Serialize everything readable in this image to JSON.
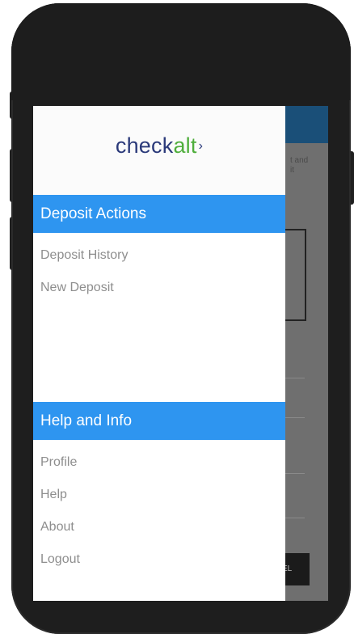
{
  "logo": {
    "part1": "check",
    "part2": "alt",
    "mark": "›"
  },
  "background": {
    "hint_text": "t and\nit",
    "button_text": "EL"
  },
  "drawer": {
    "sections": [
      {
        "title": "Deposit Actions",
        "items": [
          "Deposit History",
          "New Deposit"
        ]
      },
      {
        "title": "Help and Info",
        "items": [
          "Profile",
          "Help",
          "About",
          "Logout"
        ]
      }
    ]
  },
  "colors": {
    "section_header": "#2e95f0",
    "logo_primary": "#2b3a7a",
    "logo_accent": "#4fae3c",
    "app_header": "#1a4f78"
  }
}
